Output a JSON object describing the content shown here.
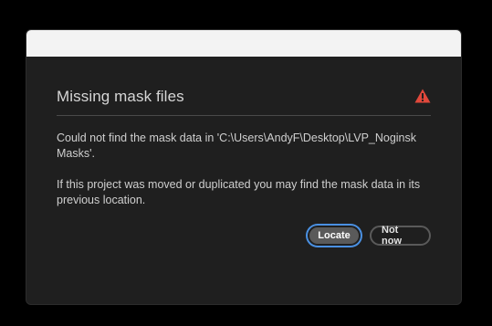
{
  "dialog": {
    "title": "Missing mask files",
    "message_line1": "Could not find the mask data in 'C:\\Users\\AndyF\\Desktop\\LVP_Noginsk Masks'.",
    "message_line2": "If this project was moved or duplicated you may find the mask data in its previous location.",
    "icon": "warning-icon",
    "warning_color": "#e0483b"
  },
  "buttons": {
    "locate_label": "Locate",
    "not_now_label": "Not now"
  }
}
